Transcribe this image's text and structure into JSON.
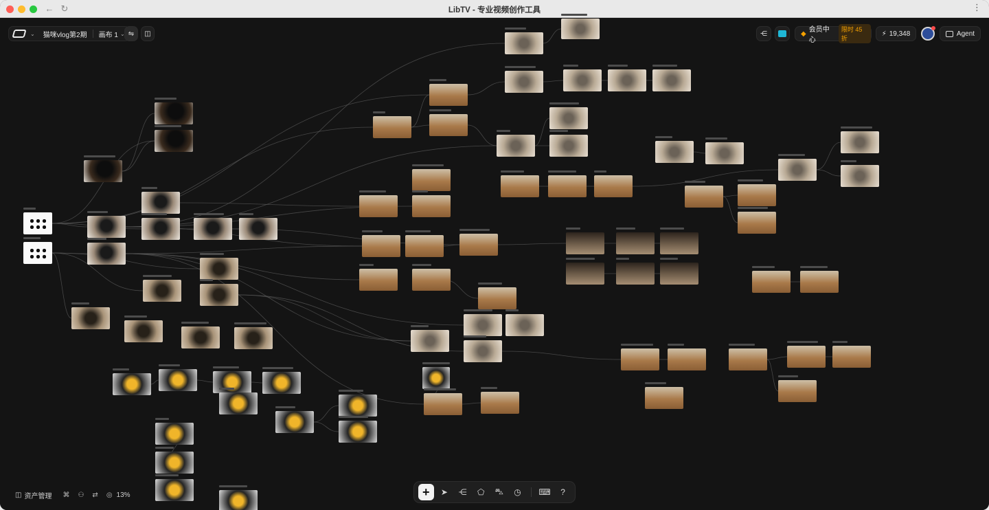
{
  "window": {
    "title": "LibTV - 专业视频创作工具"
  },
  "toolbar": {
    "project_name": "猫咪vlog第2期",
    "canvas_name": "画布 1",
    "member_label": "会员中心",
    "discount_label": "限时 45 折",
    "credits": "19,348",
    "agent_label": "Agent"
  },
  "footer": {
    "assets_label": "资产管理",
    "zoom": "13%"
  },
  "colors": {
    "accent": "#1fb7d6",
    "discount": "#f4a000",
    "canvas_bg": "#141414"
  },
  "icons": {
    "back": "arrow-left-icon",
    "reload": "reload-icon",
    "share": "share-icon",
    "layout": "layout-icon",
    "bolt": "bolt-icon",
    "gem": "gem-icon"
  }
}
